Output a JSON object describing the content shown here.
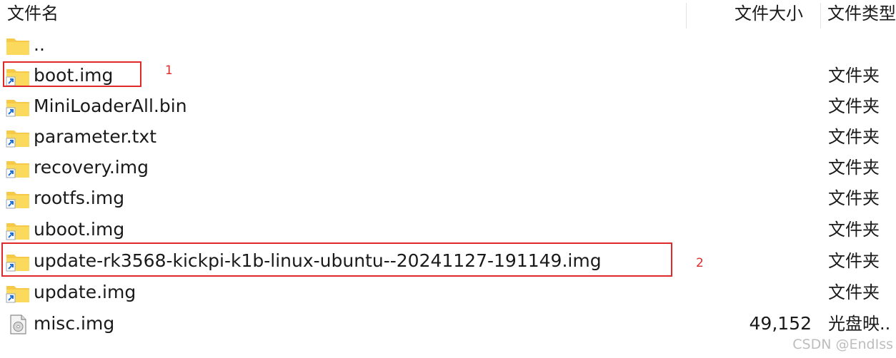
{
  "header": {
    "name": "文件名",
    "size": "文件大小",
    "type": "文件类型"
  },
  "files": [
    {
      "name": "..",
      "size": "",
      "type": "",
      "icon": "folder-icon"
    },
    {
      "name": "boot.img",
      "size": "",
      "type": "文件夹",
      "icon": "folder-shortcut-icon"
    },
    {
      "name": "MiniLoaderAll.bin",
      "size": "",
      "type": "文件夹",
      "icon": "folder-shortcut-icon"
    },
    {
      "name": "parameter.txt",
      "size": "",
      "type": "文件夹",
      "icon": "folder-shortcut-icon"
    },
    {
      "name": "recovery.img",
      "size": "",
      "type": "文件夹",
      "icon": "folder-shortcut-icon"
    },
    {
      "name": "rootfs.img",
      "size": "",
      "type": "文件夹",
      "icon": "folder-shortcut-icon"
    },
    {
      "name": "uboot.img",
      "size": "",
      "type": "文件夹",
      "icon": "folder-shortcut-icon"
    },
    {
      "name": "update-rk3568-kickpi-k1b-linux-ubuntu--20241127-191149.img",
      "size": "",
      "type": "文件夹",
      "icon": "folder-shortcut-icon"
    },
    {
      "name": "update.img",
      "size": "",
      "type": "文件夹",
      "icon": "folder-shortcut-icon"
    },
    {
      "name": "misc.img",
      "size": "49,152",
      "type": "光盘映..",
      "icon": "disc-image-file-icon"
    }
  ],
  "annotations": [
    {
      "label": "1"
    },
    {
      "label": "2"
    }
  ],
  "colors": {
    "annotation": "#e02a2a",
    "folder": "#f7c948",
    "shortcut_arrow": "#1e6fd9"
  },
  "watermark": "CSDN @EndIss"
}
